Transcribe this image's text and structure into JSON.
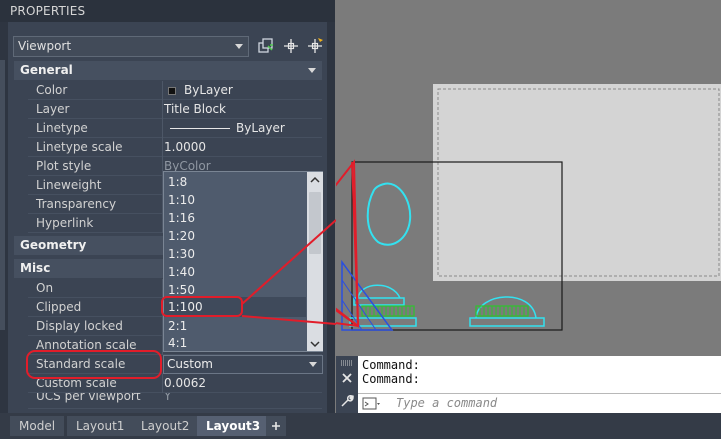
{
  "palette": {
    "title": "PROPERTIES",
    "object_type": "Viewport",
    "categories": {
      "general": "General",
      "geometry": "Geometry",
      "misc": "Misc"
    },
    "general_rows": [
      {
        "label": "Color",
        "value": "ByLayer"
      },
      {
        "label": "Layer",
        "value": "Title Block"
      },
      {
        "label": "Linetype",
        "value": "ByLayer"
      },
      {
        "label": "Linetype scale",
        "value": "1.0000"
      },
      {
        "label": "Plot style",
        "value": "ByColor"
      },
      {
        "label": "Lineweight",
        "value": ""
      },
      {
        "label": "Transparency",
        "value": ""
      },
      {
        "label": "Hyperlink",
        "value": ""
      }
    ],
    "misc_rows": [
      {
        "label": "On",
        "value": ""
      },
      {
        "label": "Clipped",
        "value": ""
      },
      {
        "label": "Display locked",
        "value": ""
      },
      {
        "label": "Annotation scale",
        "value": ""
      },
      {
        "label": "Standard scale",
        "value": "Custom"
      },
      {
        "label": "Custom scale",
        "value": "0.0062"
      },
      {
        "label": "UCS per viewport",
        "value": "Y"
      }
    ],
    "scale_options": [
      "1:8",
      "1:10",
      "1:16",
      "1:20",
      "1:30",
      "1:40",
      "1:50",
      "1:100",
      "2:1",
      "4:1"
    ],
    "selected_option": "1:100"
  },
  "command_line": {
    "history": [
      "Command:",
      "Command:"
    ],
    "placeholder": "Type a command"
  },
  "tabs": [
    {
      "label": "Model"
    },
    {
      "label": "Layout1"
    },
    {
      "label": "Layout2"
    },
    {
      "label": "Layout3"
    }
  ],
  "icons": {
    "quick_select": "quick-select-icon",
    "select_objects": "select-objects-icon",
    "pickadd": "pickadd-toggle-icon",
    "close": "close-icon",
    "settings": "wrench-icon",
    "add_tab": "plus-icon"
  },
  "colors": {
    "palette_bg": "#3b4453",
    "annotation_red": "#e11d2a",
    "geometry_cyan": "#33e1f0",
    "hatch_green": "#2ec42e",
    "paper": "#d4d4d4"
  }
}
